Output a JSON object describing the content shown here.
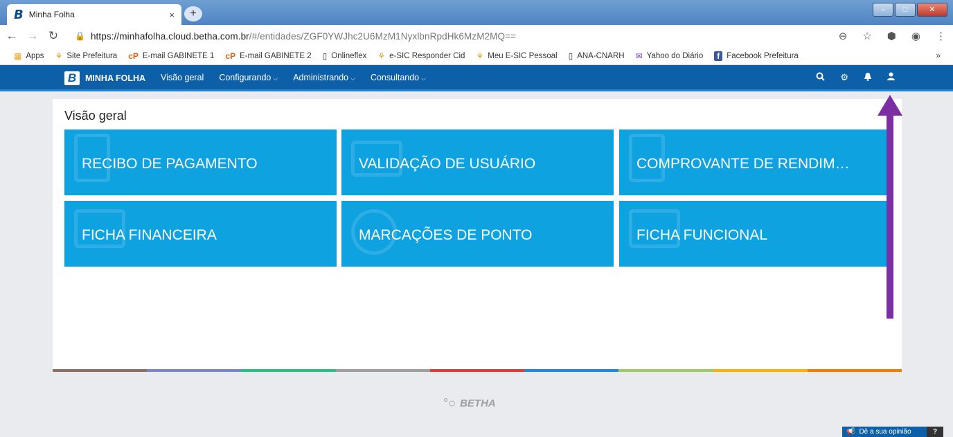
{
  "browser": {
    "tab_title": "Minha Folha",
    "tab_close": "×",
    "new_tab": "+",
    "url_main": "https://minhafolha.cloud.betha.com.br",
    "url_rest": "/#/entidades/ZGF0YWJhc2U6MzM1NyxlbnRpdHk6MzM2MQ==",
    "window_controls": [
      "–",
      "□",
      "✕"
    ]
  },
  "bookmarks": [
    {
      "icon": "apps-grid-icon",
      "label": "Apps"
    },
    {
      "icon": "site-icon",
      "label": "Site Prefeitura"
    },
    {
      "icon": "email-icon",
      "label": "E-mail GABINETE 1"
    },
    {
      "icon": "email-icon",
      "label": "E-mail GABINETE 2"
    },
    {
      "icon": "page-icon",
      "label": "Onlineflex"
    },
    {
      "icon": "site-icon",
      "label": "e-SIC Responder Cid"
    },
    {
      "icon": "site-icon",
      "label": "Meu E-SIC Pessoal"
    },
    {
      "icon": "page-icon",
      "label": "ANA-CNARH"
    },
    {
      "icon": "mail-icon",
      "label": "Yahoo do Diário"
    },
    {
      "icon": "facebook-icon",
      "label": "Facebook Prefeitura"
    }
  ],
  "bookmarks_more": "»",
  "app": {
    "logo": "B",
    "name": "MINHA FOLHA",
    "menu": [
      "Visão geral",
      "Configurando",
      "Administrando",
      "Consultando"
    ]
  },
  "page": {
    "title": "Visão geral",
    "cards": [
      "RECIBO DE PAGAMENTO",
      "VALIDAÇÃO DE USUÁRIO",
      "COMPROVANTE DE RENDIM…",
      "FICHA FINANCEIRA",
      "MARCAÇÕES DE PONTO",
      "FICHA FUNCIONAL"
    ]
  },
  "footer": {
    "brand": "BETHA",
    "feedback": "Dê a sua opinião",
    "help": "?"
  },
  "colors": {
    "appbar": "#0d5fa7",
    "card": "#0fa2e1",
    "annotation_arrow": "#7b2fa2",
    "stripe": [
      "#8d6e63",
      "#7986cb",
      "#26c281",
      "#9e9e9e",
      "#e53935",
      "#1e88e5",
      "#9ccc65",
      "#ffb300",
      "#f57c00"
    ]
  }
}
